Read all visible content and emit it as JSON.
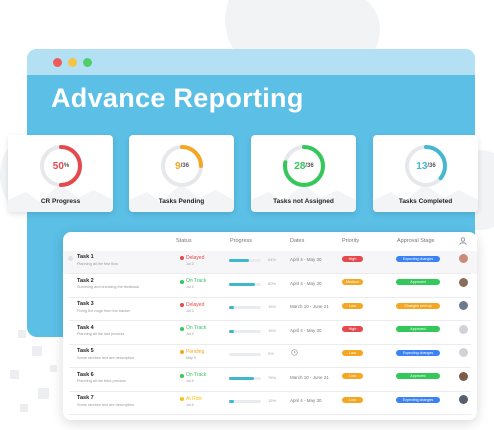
{
  "title": "Advance Reporting",
  "colors": {
    "window_bg": "#5bbfe6",
    "red": "#e5484d",
    "orange": "#f5a623",
    "green": "#34c759",
    "teal": "#45b8cf"
  },
  "cards": [
    {
      "label": "CR Progress",
      "value": "50",
      "suffix": "%",
      "progress": 0.5,
      "color": "#e5484d"
    },
    {
      "label": "Tasks Pending",
      "value": "9",
      "suffix": "/36",
      "progress": 0.25,
      "color": "#f5a623"
    },
    {
      "label": "Tasks not Assigned",
      "value": "28",
      "suffix": "/36",
      "progress": 0.78,
      "color": "#34c759"
    },
    {
      "label": "Tasks Completed",
      "value": "13",
      "suffix": "/36",
      "progress": 0.36,
      "color": "#45b8cf"
    }
  ],
  "table": {
    "headers": {
      "status": "Status",
      "progress": "Progress",
      "dates": "Dates",
      "priority": "Priority",
      "approval": "Approval Stage"
    },
    "rows": [
      {
        "name": "Task 1",
        "desc": "Planning all the first flow",
        "status": "Delayed",
        "status_color": "#e5484d",
        "status_date": "Jul 3",
        "progress": 0.64,
        "pct": "64%",
        "dates": "April 4 - May 30",
        "priority": "High",
        "priority_color": "#e5484d",
        "approval": "Expecting changes",
        "approval_color": "#3b82f6",
        "avatar_color": "#c98a7a"
      },
      {
        "name": "Task 2",
        "desc": "Summing and checking the feedback",
        "status": "On Track",
        "status_color": "#34c759",
        "status_date": "Jul 4",
        "progress": 0.8,
        "pct": "80%",
        "dates": "April 4 - May 30",
        "priority": "Medium",
        "priority_color": "#f5a623",
        "approval": "Approved",
        "approval_color": "#34c759",
        "avatar_color": "#8a6e5a"
      },
      {
        "name": "Task 3",
        "desc": "Fixing the bugs from the tracker",
        "status": "Delayed",
        "status_color": "#e5484d",
        "status_date": "Jul 3",
        "progress": 0.15,
        "pct": "15%",
        "dates": "March 10 - June 21",
        "priority": "Low",
        "priority_color": "#f5a623",
        "approval": "Changes sent up",
        "approval_color": "#f5a623",
        "avatar_color": "#6b7b8c"
      },
      {
        "name": "Task 4",
        "desc": "Planning all the last process",
        "status": "On Track",
        "status_color": "#34c759",
        "status_date": "Jul 4",
        "progress": 0.15,
        "pct": "15%",
        "dates": "April 4 - May 30",
        "priority": "High",
        "priority_color": "#e5484d",
        "approval": "Approved",
        "approval_color": "#34c759",
        "avatar_color": "#cfd3d8"
      },
      {
        "name": "Task 5",
        "desc": "Some random text are description",
        "status": "Pending",
        "status_color": "#f5a623",
        "status_date": "May 9",
        "progress": 0.0,
        "pct": "0%",
        "dates": "",
        "priority": "Low",
        "priority_color": "#f5a623",
        "approval": "Expecting changes",
        "approval_color": "#3b82f6",
        "avatar_color": "#cfd3d8"
      },
      {
        "name": "Task 6",
        "desc": "Planning all the third process",
        "status": "On Track",
        "status_color": "#34c759",
        "status_date": "Jul 4",
        "progress": 0.78,
        "pct": "78%",
        "dates": "March 10 - June 21",
        "priority": "Low",
        "priority_color": "#f5a623",
        "approval": "Approved",
        "approval_color": "#34c759",
        "avatar_color": "#7a5c48"
      },
      {
        "name": "Task 7",
        "desc": "Some random text are description",
        "status": "At Risk",
        "status_color": "#f5c518",
        "status_date": "Jul 4",
        "progress": 0.15,
        "pct": "15%",
        "dates": "April 4 - May 30",
        "priority": "Low",
        "priority_color": "#f5a623",
        "approval": "Expecting changes",
        "approval_color": "#3b82f6",
        "avatar_color": "#55606c"
      }
    ]
  }
}
